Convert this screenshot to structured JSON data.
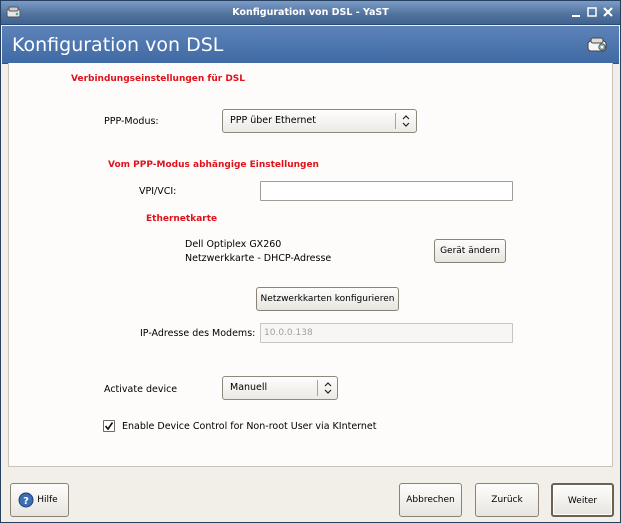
{
  "window": {
    "title": "Konfiguration von DSL - YaST"
  },
  "banner": {
    "heading": "Konfiguration von DSL"
  },
  "sections": {
    "connection": "Verbindungseinstellungen für DSL",
    "ppp_dependent": "Vom PPP-Modus abhängige Einstellungen",
    "ethernet_card": "Ethernetkarte"
  },
  "ppp_mode": {
    "label": "PPP-Modus:",
    "value": "PPP über Ethernet"
  },
  "vpi_vci": {
    "label": "VPI/VCI:",
    "value": ""
  },
  "ethernet": {
    "device_name": "Dell Optiplex GX260",
    "device_detail": "Netzwerkkarte - DHCP-Adresse",
    "change_button": "Gerät ändern",
    "configure_button": "Netzwerkkarten konfigurieren"
  },
  "modem_ip": {
    "label": "IP-Adresse des Modems:",
    "value": "10.0.0.138"
  },
  "activate_device": {
    "label": "Activate device",
    "value": "Manuell"
  },
  "kinternet": {
    "label": "Enable Device Control for Non-root User via KInternet",
    "checked": true
  },
  "footer": {
    "help": "Hilfe",
    "cancel": "Abbrechen",
    "back": "Zurück",
    "next": "Weiter"
  },
  "colors": {
    "section_heading": "#e0121a",
    "banner": "#4a72aa",
    "titlebar": "#53749f"
  }
}
